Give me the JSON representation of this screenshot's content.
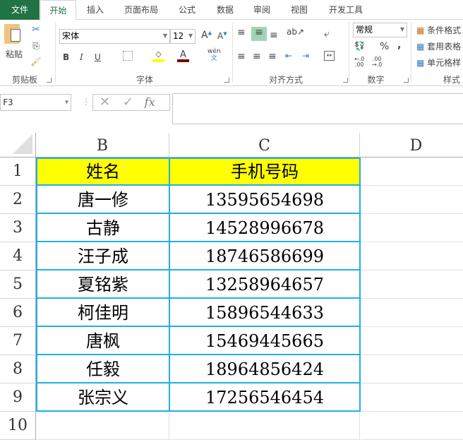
{
  "tabs": [
    "文件",
    "开始",
    "插入",
    "页面布局",
    "公式",
    "数据",
    "审阅",
    "视图",
    "开发工具"
  ],
  "ribbon": {
    "clipboard": {
      "paste": "粘贴",
      "label": "剪贴板"
    },
    "font": {
      "name": "宋体",
      "size": "12",
      "bold": "B",
      "italic": "I",
      "underline": "U",
      "phonetic": "wén",
      "label": "字体"
    },
    "alignment": {
      "label": "对齐方式"
    },
    "number": {
      "format": "常规",
      "percent": "%",
      "comma": ",",
      "inc": ".00",
      "label": "数字"
    },
    "styles": {
      "conditional": "条件格式",
      "table": "套用表格",
      "cell": "单元格样",
      "label": "样式"
    }
  },
  "formula_bar": {
    "name_box": "F3",
    "fx": "fx",
    "value": ""
  },
  "columns": [
    "B",
    "C",
    "D"
  ],
  "rows": [
    "1",
    "2",
    "3",
    "4",
    "5",
    "6",
    "7",
    "8",
    "9",
    "10"
  ],
  "table": {
    "header": [
      "姓名",
      "手机号码"
    ],
    "rows": [
      [
        "唐一修",
        "13595654698"
      ],
      [
        "古静",
        "14528996678"
      ],
      [
        "汪子成",
        "18746586699"
      ],
      [
        "夏铭紫",
        "13258964657"
      ],
      [
        "柯佳明",
        "15896544633"
      ],
      [
        "唐枫",
        "15469445665"
      ],
      [
        "任毅",
        "18964856424"
      ],
      [
        "张宗义",
        "17256546454"
      ]
    ]
  },
  "colors": {
    "header_fill": "#ffff00",
    "border": "#1fb0e6",
    "file_tab": "#217346"
  }
}
